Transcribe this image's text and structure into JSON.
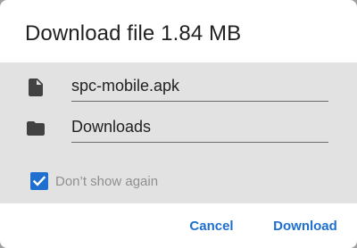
{
  "dialog": {
    "title": "Download file 1.84 MB"
  },
  "fields": {
    "file_name": {
      "value": "spc-mobile.apk",
      "icon": "file-icon"
    },
    "location": {
      "value": "Downloads",
      "icon": "folder-icon"
    }
  },
  "checkbox": {
    "label": "Don’t show again",
    "checked": true
  },
  "actions": {
    "cancel_label": "Cancel",
    "download_label": "Download"
  },
  "colors": {
    "accent": "#1e6fd0",
    "panel_background": "#e2e2e2",
    "icon": "#424242"
  }
}
